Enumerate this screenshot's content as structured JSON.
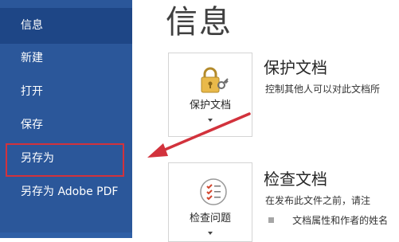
{
  "sidebar": {
    "items": [
      {
        "label": "信息"
      },
      {
        "label": "新建"
      },
      {
        "label": "打开"
      },
      {
        "label": "保存"
      },
      {
        "label": "另存为"
      },
      {
        "label": "另存为 Adobe PDF"
      }
    ]
  },
  "main": {
    "title": "信息",
    "protect": {
      "tile_label": "保护文档",
      "heading": "保护文档",
      "description": "控制其他人可以对此文档所",
      "icon": "lock-key-icon"
    },
    "inspect": {
      "tile_label": "检查问题",
      "heading": "检查文档",
      "description": "在发布此文件之前，请注",
      "bullet": "文档属性和作者的姓名",
      "icon": "checklist-icon"
    }
  },
  "colors": {
    "sidebar_bg": "#2b579a",
    "sidebar_active": "#1e4686",
    "annotation_red": "#d2323c"
  }
}
